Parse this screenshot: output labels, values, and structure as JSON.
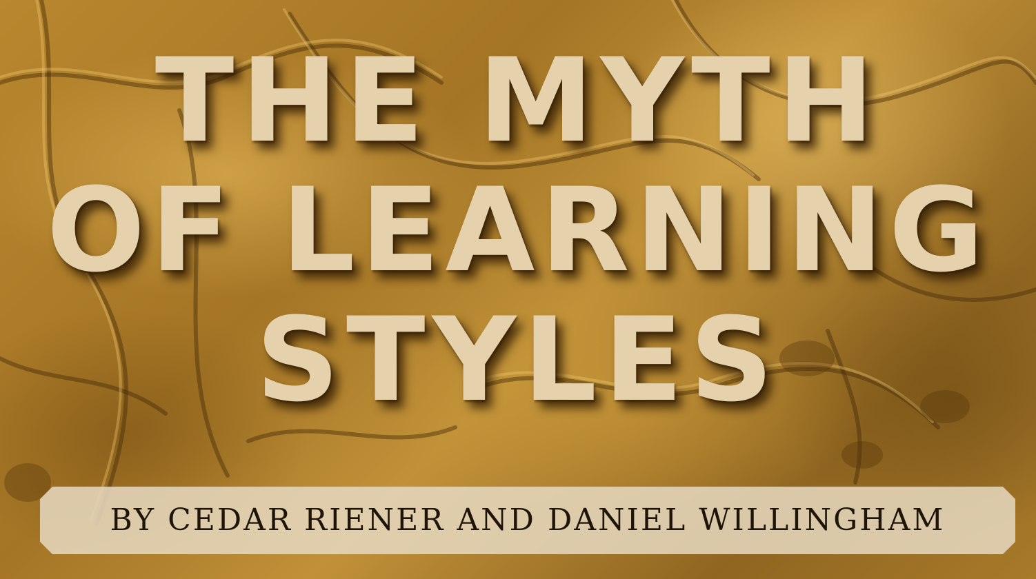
{
  "title": {
    "line1": "THE MYTH",
    "line2": "OF LEARNING",
    "line3": "STYLES"
  },
  "byline": "BY CEDAR RIENER AND DANIEL WILLINGHAM",
  "colors": {
    "background": "#a47525",
    "title_text": "#e5d2ad",
    "byline_banner": "#e4d6bc",
    "byline_text": "#1e1408"
  }
}
